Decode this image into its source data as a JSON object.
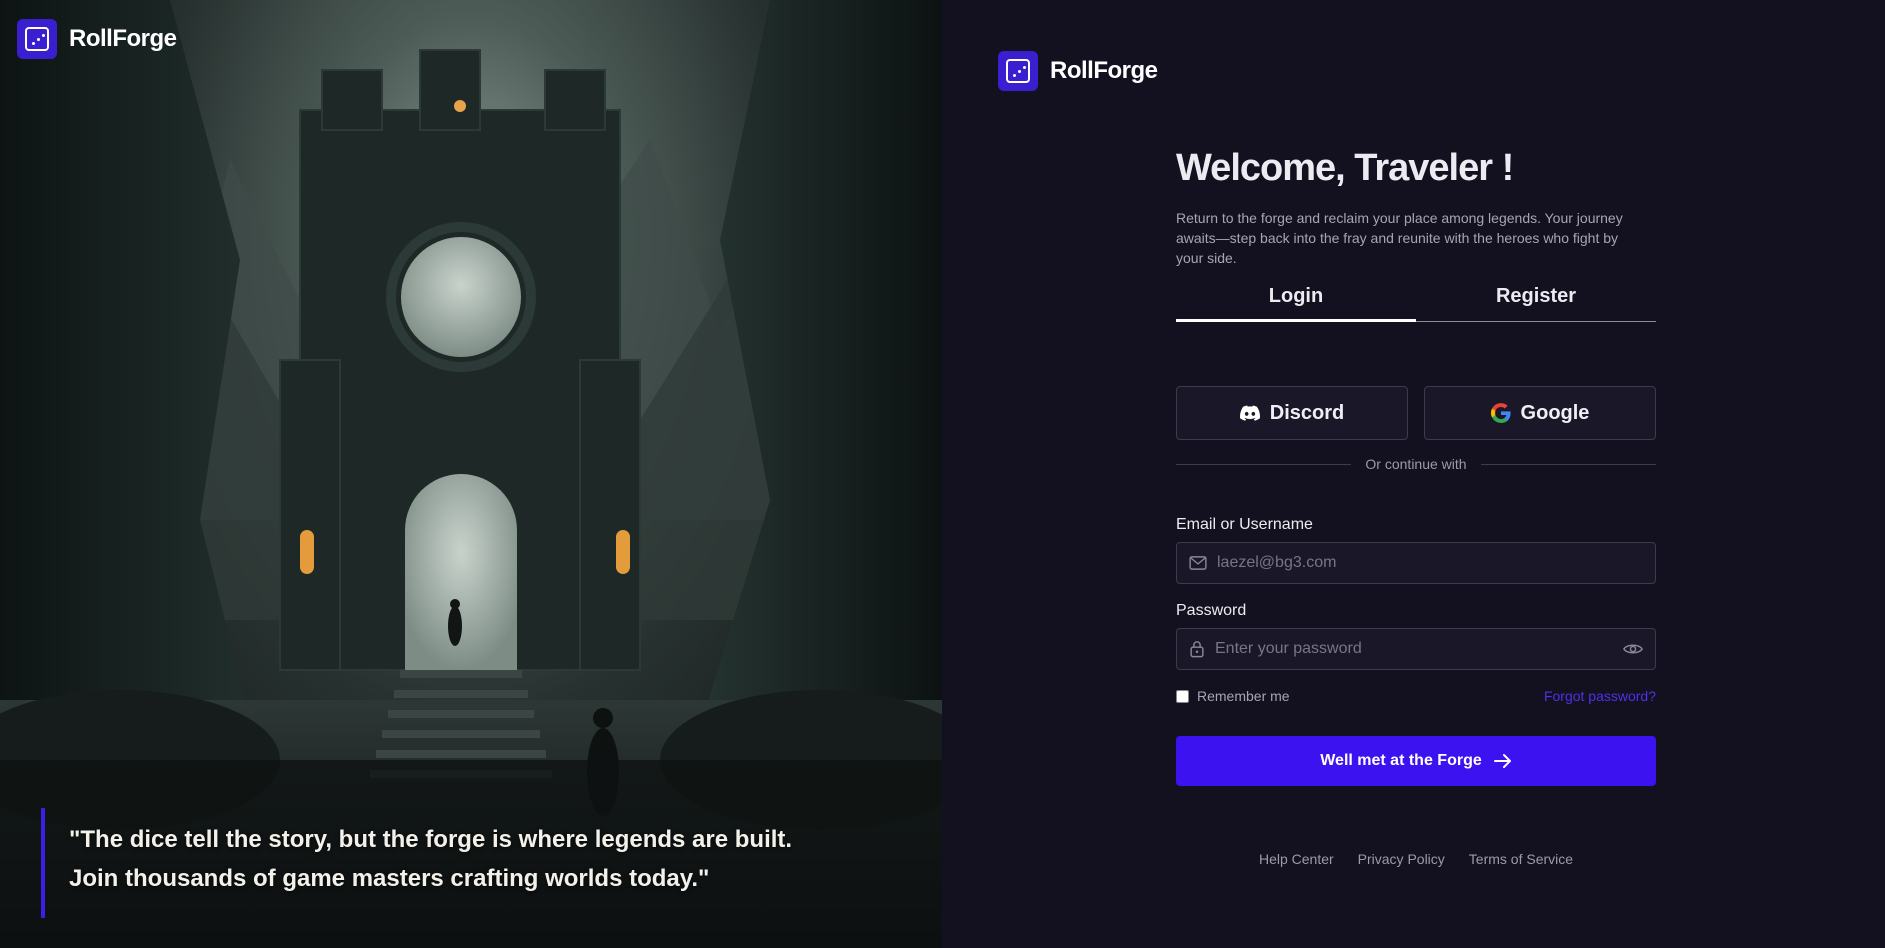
{
  "brand": {
    "name": "RollForge",
    "logo_icon": "dice-icon",
    "accent": "#3d12f0"
  },
  "hero": {
    "quote": "\"The dice tell the story, but the forge is where legends are built. Join thousands of game masters crafting worlds today.\""
  },
  "form": {
    "title": "Welcome, Traveler !",
    "subtitle": "Return to the forge and reclaim your place among legends. Your journey awaits—step back into the fray and reunite with the heroes who fight by your side.",
    "tabs": [
      {
        "label": "Login",
        "active": true
      },
      {
        "label": "Register",
        "active": false
      }
    ],
    "social": {
      "discord_label": "Discord",
      "google_label": "Google"
    },
    "divider_text": "Or continue with",
    "email": {
      "label": "Email or Username",
      "placeholder": "laezel@bg3.com",
      "value": ""
    },
    "password": {
      "label": "Password",
      "placeholder": "Enter your password",
      "value": ""
    },
    "remember_label": "Remember me",
    "forgot_label": "Forgot password?",
    "submit_label": "Well met at the Forge"
  },
  "footer": {
    "links": [
      "Help Center",
      "Privacy Policy",
      "Terms of Service"
    ]
  }
}
